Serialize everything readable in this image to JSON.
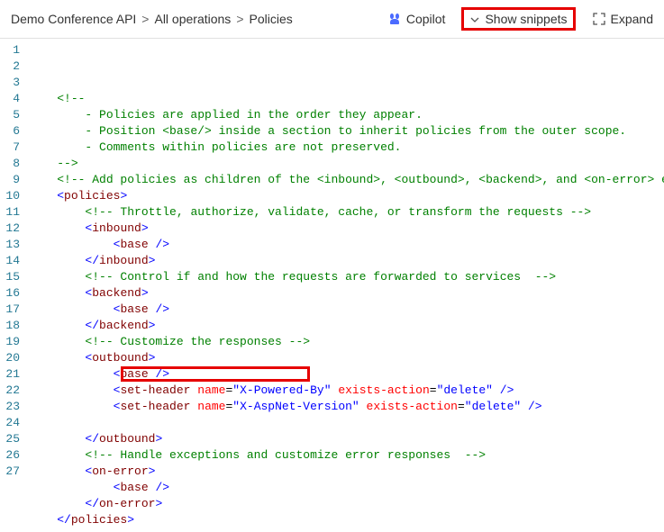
{
  "breadcrumb": {
    "items": [
      "Demo Conference API",
      "All operations",
      "Policies"
    ]
  },
  "toolbar": {
    "copilot_label": "Copilot",
    "show_snippets_label": "Show snippets",
    "expand_label": "Expand"
  },
  "code": {
    "lines": [
      {
        "n": 1,
        "tokens": [
          {
            "t": "    ",
            "c": ""
          },
          {
            "t": "<!--",
            "c": "c-comment"
          }
        ]
      },
      {
        "n": 2,
        "tokens": [
          {
            "t": "        - Policies are applied in the order they appear.",
            "c": "c-comment"
          }
        ]
      },
      {
        "n": 3,
        "tokens": [
          {
            "t": "        - Position <base/> inside a section to inherit policies from the outer scope.",
            "c": "c-comment"
          }
        ]
      },
      {
        "n": 4,
        "tokens": [
          {
            "t": "        - Comments within policies are not preserved.",
            "c": "c-comment"
          }
        ]
      },
      {
        "n": 5,
        "tokens": [
          {
            "t": "    ",
            "c": ""
          },
          {
            "t": "-->",
            "c": "c-comment"
          }
        ]
      },
      {
        "n": 6,
        "tokens": [
          {
            "t": "    ",
            "c": ""
          },
          {
            "t": "<!-- Add policies as children of the <inbound>, <outbound>, <backend>, and <on-error> ele",
            "c": "c-comment"
          }
        ]
      },
      {
        "n": 7,
        "tokens": [
          {
            "t": "    ",
            "c": ""
          },
          {
            "t": "<",
            "c": "c-bracket"
          },
          {
            "t": "policies",
            "c": "c-tag"
          },
          {
            "t": ">",
            "c": "c-bracket"
          }
        ]
      },
      {
        "n": 8,
        "tokens": [
          {
            "t": "        ",
            "c": ""
          },
          {
            "t": "<!-- Throttle, authorize, validate, cache, or transform the requests -->",
            "c": "c-comment"
          }
        ]
      },
      {
        "n": 9,
        "tokens": [
          {
            "t": "        ",
            "c": ""
          },
          {
            "t": "<",
            "c": "c-bracket"
          },
          {
            "t": "inbound",
            "c": "c-tag"
          },
          {
            "t": ">",
            "c": "c-bracket"
          }
        ]
      },
      {
        "n": 10,
        "tokens": [
          {
            "t": "            ",
            "c": ""
          },
          {
            "t": "<",
            "c": "c-bracket"
          },
          {
            "t": "base",
            "c": "c-tag"
          },
          {
            "t": " />",
            "c": "c-bracket"
          }
        ]
      },
      {
        "n": 11,
        "tokens": [
          {
            "t": "        ",
            "c": ""
          },
          {
            "t": "</",
            "c": "c-bracket"
          },
          {
            "t": "inbound",
            "c": "c-tag"
          },
          {
            "t": ">",
            "c": "c-bracket"
          }
        ]
      },
      {
        "n": 12,
        "tokens": [
          {
            "t": "        ",
            "c": ""
          },
          {
            "t": "<!-- Control if and how the requests are forwarded to services  -->",
            "c": "c-comment"
          }
        ]
      },
      {
        "n": 13,
        "tokens": [
          {
            "t": "        ",
            "c": ""
          },
          {
            "t": "<",
            "c": "c-bracket"
          },
          {
            "t": "backend",
            "c": "c-tag"
          },
          {
            "t": ">",
            "c": "c-bracket"
          }
        ]
      },
      {
        "n": 14,
        "tokens": [
          {
            "t": "            ",
            "c": ""
          },
          {
            "t": "<",
            "c": "c-bracket"
          },
          {
            "t": "base",
            "c": "c-tag"
          },
          {
            "t": " />",
            "c": "c-bracket"
          }
        ]
      },
      {
        "n": 15,
        "tokens": [
          {
            "t": "        ",
            "c": ""
          },
          {
            "t": "</",
            "c": "c-bracket"
          },
          {
            "t": "backend",
            "c": "c-tag"
          },
          {
            "t": ">",
            "c": "c-bracket"
          }
        ]
      },
      {
        "n": 16,
        "tokens": [
          {
            "t": "        ",
            "c": ""
          },
          {
            "t": "<!-- Customize the responses -->",
            "c": "c-comment"
          }
        ]
      },
      {
        "n": 17,
        "tokens": [
          {
            "t": "        ",
            "c": ""
          },
          {
            "t": "<",
            "c": "c-bracket"
          },
          {
            "t": "outbound",
            "c": "c-tag"
          },
          {
            "t": ">",
            "c": "c-bracket"
          }
        ]
      },
      {
        "n": 18,
        "tokens": [
          {
            "t": "            ",
            "c": ""
          },
          {
            "t": "<",
            "c": "c-bracket"
          },
          {
            "t": "base",
            "c": "c-tag"
          },
          {
            "t": " />",
            "c": "c-bracket"
          }
        ]
      },
      {
        "n": 19,
        "tokens": [
          {
            "t": "            ",
            "c": ""
          },
          {
            "t": "<",
            "c": "c-bracket"
          },
          {
            "t": "set-header",
            "c": "c-tag"
          },
          {
            "t": " ",
            "c": ""
          },
          {
            "t": "name",
            "c": "c-attr"
          },
          {
            "t": "=",
            "c": ""
          },
          {
            "t": "\"X-Powered-By\"",
            "c": "c-val"
          },
          {
            "t": " ",
            "c": ""
          },
          {
            "t": "exists-action",
            "c": "c-attr"
          },
          {
            "t": "=",
            "c": ""
          },
          {
            "t": "\"delete\"",
            "c": "c-val"
          },
          {
            "t": " />",
            "c": "c-bracket"
          }
        ]
      },
      {
        "n": 20,
        "tokens": [
          {
            "t": "            ",
            "c": ""
          },
          {
            "t": "<",
            "c": "c-bracket"
          },
          {
            "t": "set-header",
            "c": "c-tag"
          },
          {
            "t": " ",
            "c": ""
          },
          {
            "t": "name",
            "c": "c-attr"
          },
          {
            "t": "=",
            "c": ""
          },
          {
            "t": "\"X-AspNet-Version\"",
            "c": "c-val"
          },
          {
            "t": " ",
            "c": ""
          },
          {
            "t": "exists-action",
            "c": "c-attr"
          },
          {
            "t": "=",
            "c": ""
          },
          {
            "t": "\"delete\"",
            "c": "c-val"
          },
          {
            "t": " />",
            "c": "c-bracket"
          }
        ]
      },
      {
        "n": 21,
        "tokens": [
          {
            "t": " ",
            "c": ""
          }
        ]
      },
      {
        "n": 22,
        "tokens": [
          {
            "t": "        ",
            "c": ""
          },
          {
            "t": "</",
            "c": "c-bracket"
          },
          {
            "t": "outbound",
            "c": "c-tag"
          },
          {
            "t": ">",
            "c": "c-bracket"
          }
        ]
      },
      {
        "n": 23,
        "tokens": [
          {
            "t": "        ",
            "c": ""
          },
          {
            "t": "<!-- Handle exceptions and customize error responses  -->",
            "c": "c-comment"
          }
        ]
      },
      {
        "n": 24,
        "tokens": [
          {
            "t": "        ",
            "c": ""
          },
          {
            "t": "<",
            "c": "c-bracket"
          },
          {
            "t": "on-error",
            "c": "c-tag"
          },
          {
            "t": ">",
            "c": "c-bracket"
          }
        ]
      },
      {
        "n": 25,
        "tokens": [
          {
            "t": "            ",
            "c": ""
          },
          {
            "t": "<",
            "c": "c-bracket"
          },
          {
            "t": "base",
            "c": "c-tag"
          },
          {
            "t": " />",
            "c": "c-bracket"
          }
        ]
      },
      {
        "n": 26,
        "tokens": [
          {
            "t": "        ",
            "c": ""
          },
          {
            "t": "</",
            "c": "c-bracket"
          },
          {
            "t": "on-error",
            "c": "c-tag"
          },
          {
            "t": ">",
            "c": "c-bracket"
          }
        ]
      },
      {
        "n": 27,
        "tokens": [
          {
            "t": "    ",
            "c": ""
          },
          {
            "t": "</",
            "c": "c-bracket"
          },
          {
            "t": "policies",
            "c": "c-tag"
          },
          {
            "t": ">",
            "c": "c-bracket"
          }
        ]
      }
    ]
  }
}
